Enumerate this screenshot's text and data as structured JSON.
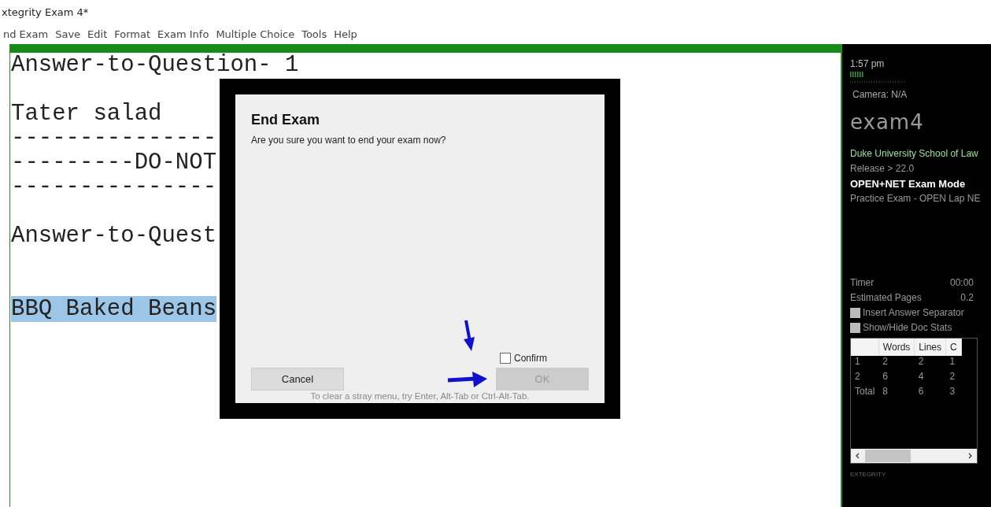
{
  "window": {
    "title": "xtegrity Exam 4*"
  },
  "menu": [
    "nd Exam",
    "Save",
    "Edit",
    "Format",
    "Exam Info",
    "Multiple Choice",
    "Tools",
    "Help"
  ],
  "editor": {
    "lines": [
      {
        "kind": "text",
        "text": "Answer-to-Question- 1",
        "selected": false
      },
      {
        "kind": "blank"
      },
      {
        "kind": "text",
        "text": "Tater salad",
        "selected": false
      },
      {
        "kind": "text",
        "text": "---------------",
        "selected": false
      },
      {
        "kind": "text",
        "text": "---------DO-NOT",
        "selected": false
      },
      {
        "kind": "text",
        "text": "---------------",
        "selected": false
      },
      {
        "kind": "blank"
      },
      {
        "kind": "text",
        "text": "Answer-to-Quest",
        "selected": false
      },
      {
        "kind": "blank"
      },
      {
        "kind": "blank"
      },
      {
        "kind": "text",
        "text": "BBQ Baked Beans",
        "selected": true
      }
    ]
  },
  "side_panel": {
    "time": "1:57 pm",
    "camera": "Camera: N/A",
    "logo": "exam4",
    "school": "Duke University School of Law",
    "release": "Release > 22.0",
    "mode": "OPEN+NET Exam Mode",
    "exam": "Practice Exam - OPEN Lap NE",
    "stats": [
      {
        "label": "Timer",
        "value": "00:00"
      },
      {
        "label": "Estimated Pages",
        "value": "0.2"
      }
    ],
    "options": [
      {
        "label": "Insert Answer Separator",
        "checked": false
      },
      {
        "label": "Show/Hide Doc Stats",
        "checked": false
      }
    ],
    "table": {
      "columns": [
        "",
        "Words",
        "Lines",
        "C"
      ],
      "rows": [
        [
          "1",
          "2",
          "2",
          "1"
        ],
        [
          "2",
          "6",
          "4",
          "2"
        ],
        [
          "Total",
          "8",
          "6",
          "3"
        ]
      ]
    },
    "footer": "EXTEGRITY"
  },
  "dialog": {
    "title": "End Exam",
    "message": "Are you sure you want to end your exam now?",
    "confirm": {
      "label": "Confirm",
      "checked": false
    },
    "buttons": [
      {
        "label": "Cancel",
        "disabled": false
      },
      {
        "label": "OK",
        "disabled": true
      }
    ],
    "hint": "To clear a stray menu, try Enter, Alt-Tab or Ctrl-Alt-Tab."
  }
}
